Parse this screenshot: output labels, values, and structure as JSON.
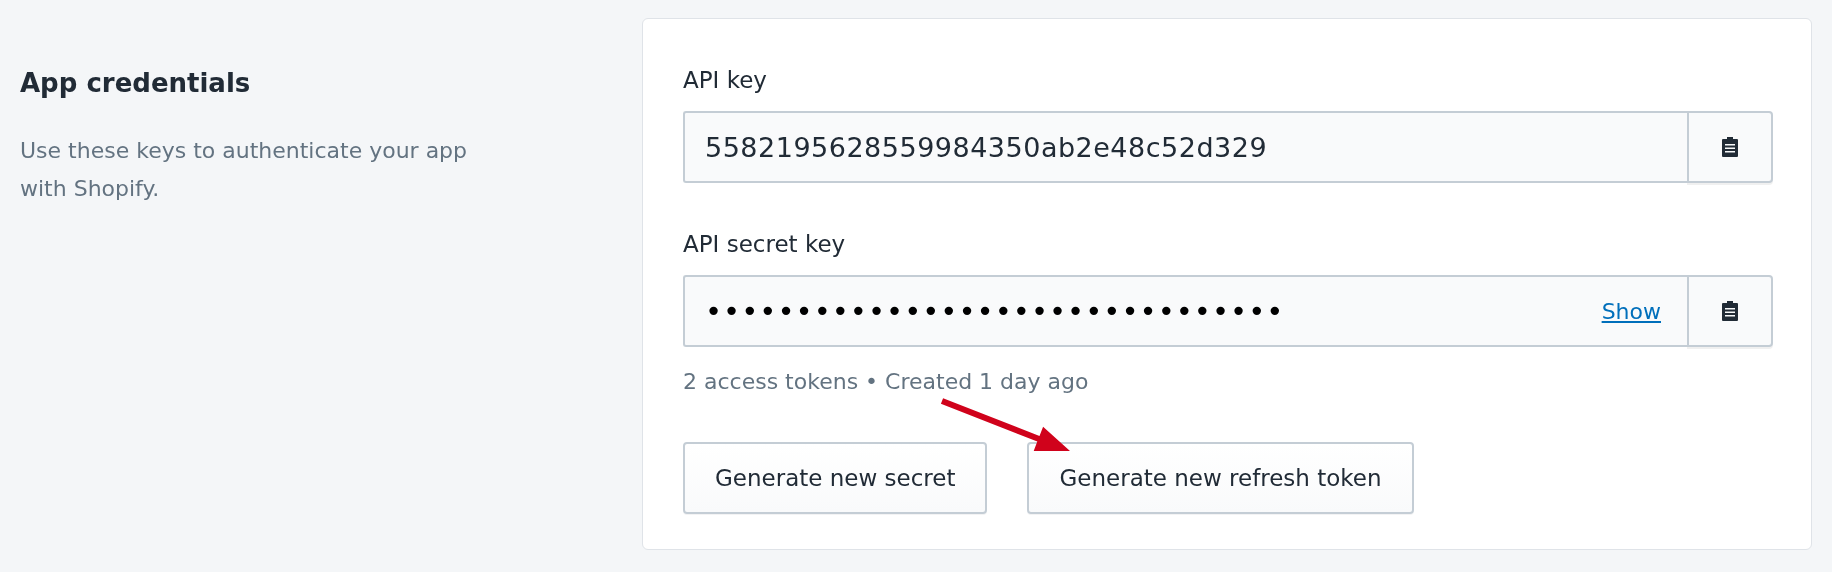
{
  "section": {
    "title": "App credentials",
    "description": "Use these keys to authenticate your app with Shopify."
  },
  "fields": [
    {
      "kind": "text",
      "label": "API key",
      "value": "5582195628559984350ab2e48c52d329"
    },
    {
      "kind": "secret",
      "label": "API secret key",
      "value": "••••••••••••••••••••••••••••••••",
      "link": "Show",
      "note": "2 access tokens • Created 1 day ago"
    }
  ],
  "buttons": [
    "Generate new secret",
    "Generate new refresh token"
  ]
}
